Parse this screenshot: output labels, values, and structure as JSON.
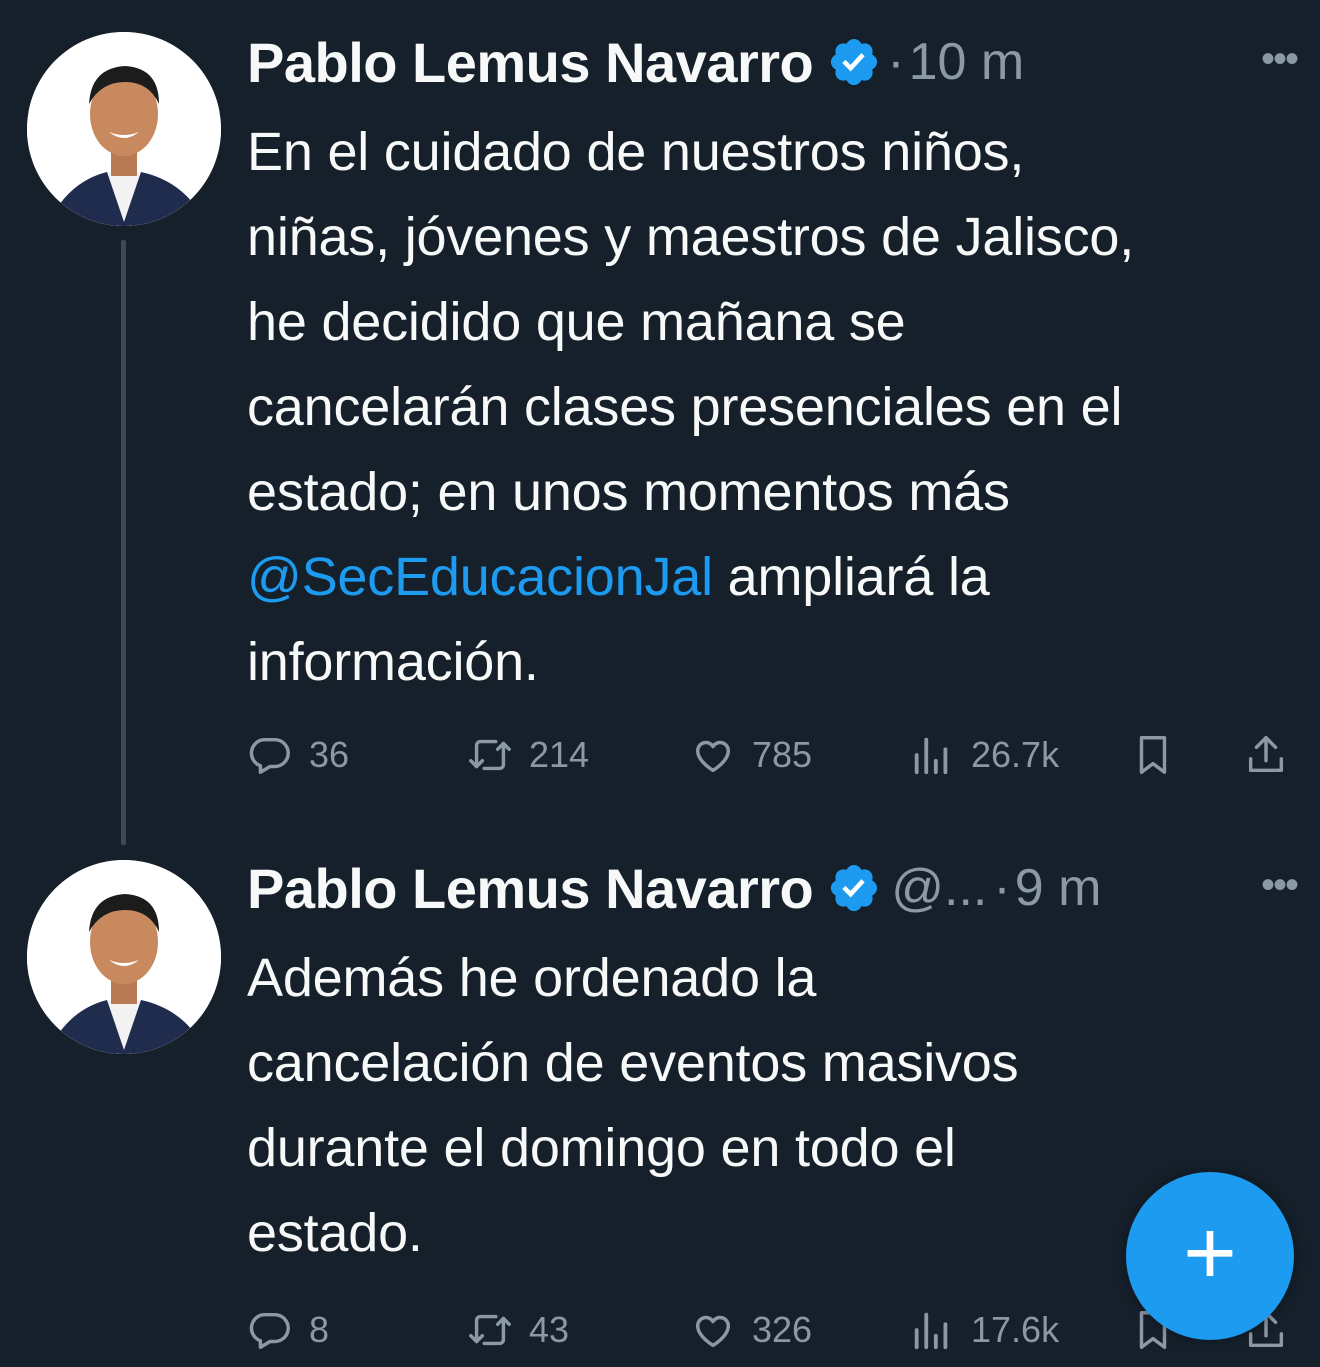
{
  "tweets": [
    {
      "author": "Pablo Lemus Navarro",
      "handle": "",
      "time": "10 m",
      "text_lines": [
        "En el cuidado de nuestros niños,",
        "niñas, jóvenes y maestros de Jalisco,",
        "he decidido que mañana se",
        "cancelarán clases presenciales en el",
        "estado; en unos momentos más"
      ],
      "mention": "@SecEducacionJal",
      "after_mention": " ampliará la",
      "last_line": "información.",
      "replies": "36",
      "retweets": "214",
      "likes": "785",
      "views": "26.7k"
    },
    {
      "author": "Pablo Lemus Navarro",
      "handle": "@...",
      "time": "9 m",
      "text_lines": [
        "Además he ordenado la",
        "cancelación de eventos masivos",
        "durante el domingo en todo el",
        "estado."
      ],
      "replies": "8",
      "retweets": "43",
      "likes": "326",
      "views": "17.6k"
    }
  ],
  "separator": "·",
  "more_label": "•••",
  "fab_label": "+",
  "colors": {
    "background": "#15202b",
    "accent": "#1d9bf0",
    "muted": "#8b98a5",
    "text": "#f7f9f9"
  },
  "icons": [
    "verified-badge-icon",
    "reply-icon",
    "retweet-icon",
    "like-icon",
    "views-icon",
    "bookmark-icon",
    "share-icon",
    "more-icon",
    "compose-icon"
  ]
}
